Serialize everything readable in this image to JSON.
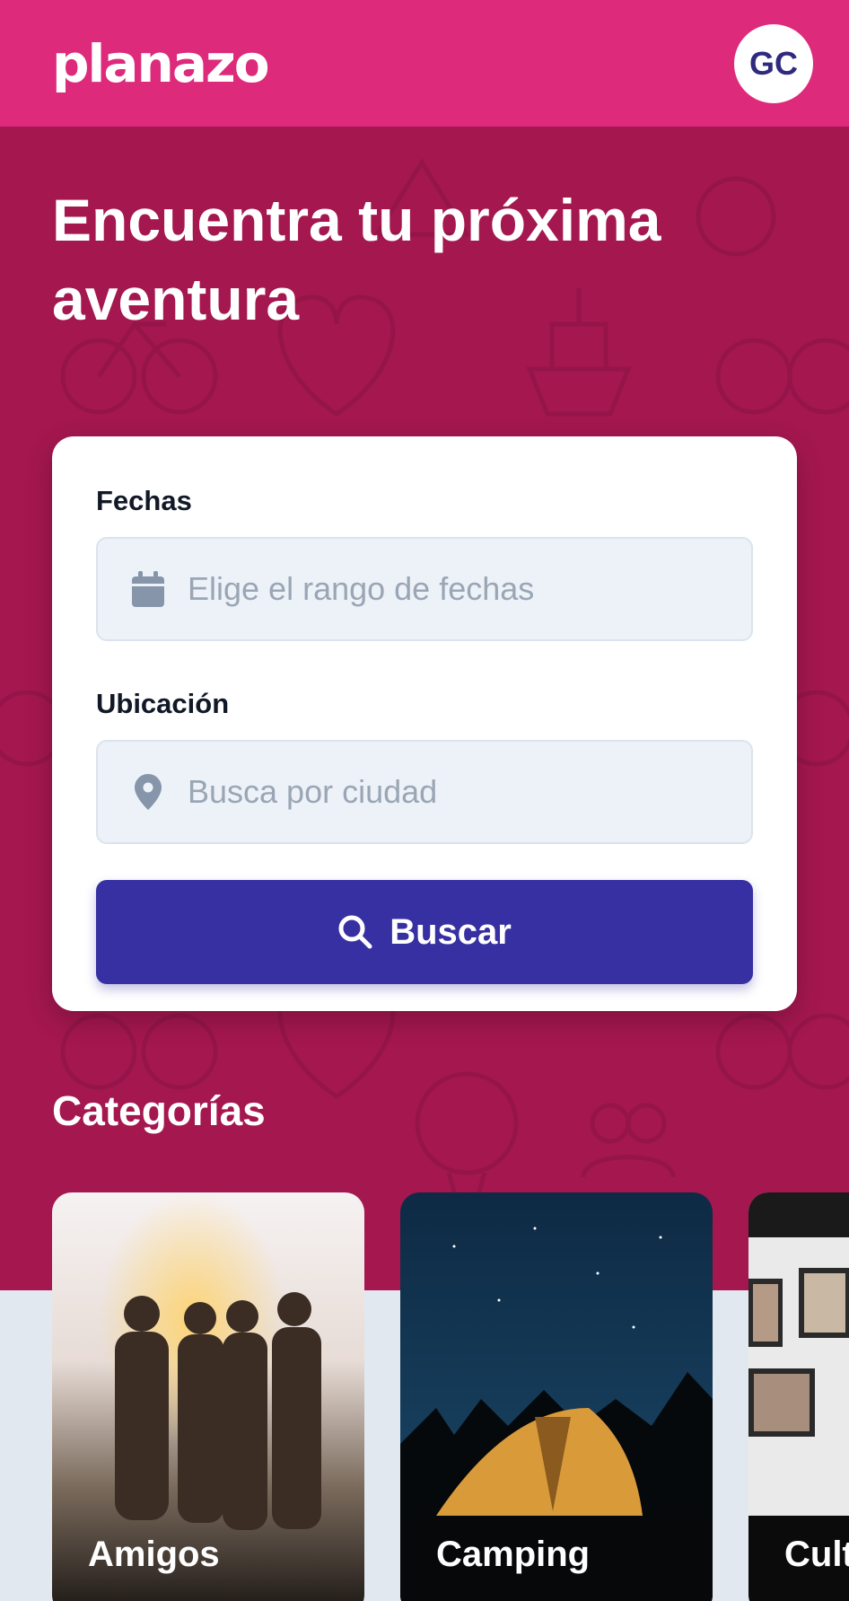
{
  "header": {
    "logo": "planazo",
    "avatar_initials": "GC"
  },
  "hero": {
    "headline": "Encuentra tu próxima aventura"
  },
  "search_form": {
    "dates_label": "Fechas",
    "dates_placeholder": "Elige el rango de fechas",
    "location_label": "Ubicación",
    "location_placeholder": "Busca por ciudad",
    "search_button": "Buscar"
  },
  "categories": {
    "title": "Categorías",
    "items": [
      {
        "label": "Amigos"
      },
      {
        "label": "Camping"
      },
      {
        "label": "Cult"
      }
    ]
  },
  "colors": {
    "brand_pink": "#dd2a7b",
    "hero_bg": "#a4174f",
    "primary_button": "#3730a3"
  }
}
